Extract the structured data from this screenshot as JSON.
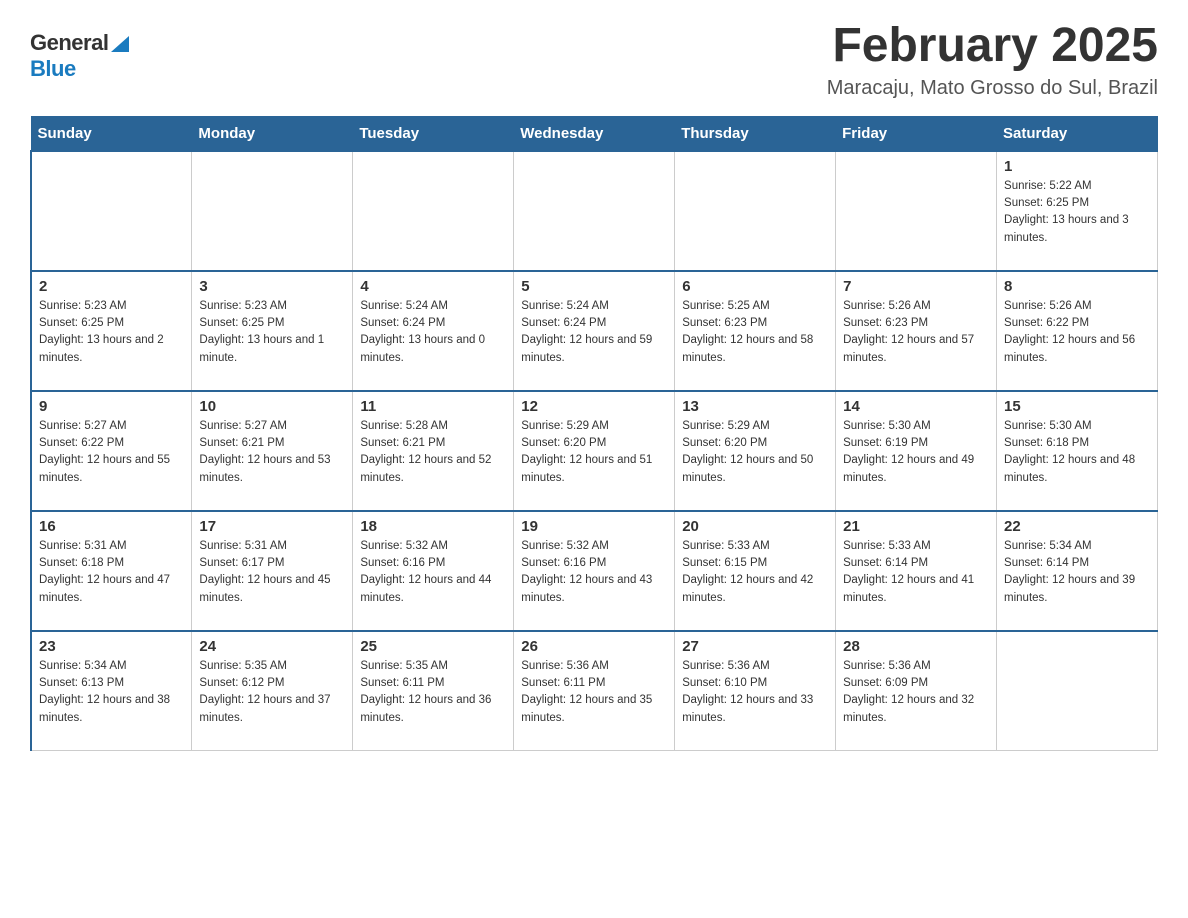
{
  "header": {
    "logo_general": "General",
    "logo_blue": "Blue",
    "title": "February 2025",
    "subtitle": "Maracaju, Mato Grosso do Sul, Brazil"
  },
  "calendar": {
    "days_of_week": [
      "Sunday",
      "Monday",
      "Tuesday",
      "Wednesday",
      "Thursday",
      "Friday",
      "Saturday"
    ],
    "weeks": [
      [
        {
          "day": "",
          "info": ""
        },
        {
          "day": "",
          "info": ""
        },
        {
          "day": "",
          "info": ""
        },
        {
          "day": "",
          "info": ""
        },
        {
          "day": "",
          "info": ""
        },
        {
          "day": "",
          "info": ""
        },
        {
          "day": "1",
          "info": "Sunrise: 5:22 AM\nSunset: 6:25 PM\nDaylight: 13 hours and 3 minutes."
        }
      ],
      [
        {
          "day": "2",
          "info": "Sunrise: 5:23 AM\nSunset: 6:25 PM\nDaylight: 13 hours and 2 minutes."
        },
        {
          "day": "3",
          "info": "Sunrise: 5:23 AM\nSunset: 6:25 PM\nDaylight: 13 hours and 1 minute."
        },
        {
          "day": "4",
          "info": "Sunrise: 5:24 AM\nSunset: 6:24 PM\nDaylight: 13 hours and 0 minutes."
        },
        {
          "day": "5",
          "info": "Sunrise: 5:24 AM\nSunset: 6:24 PM\nDaylight: 12 hours and 59 minutes."
        },
        {
          "day": "6",
          "info": "Sunrise: 5:25 AM\nSunset: 6:23 PM\nDaylight: 12 hours and 58 minutes."
        },
        {
          "day": "7",
          "info": "Sunrise: 5:26 AM\nSunset: 6:23 PM\nDaylight: 12 hours and 57 minutes."
        },
        {
          "day": "8",
          "info": "Sunrise: 5:26 AM\nSunset: 6:22 PM\nDaylight: 12 hours and 56 minutes."
        }
      ],
      [
        {
          "day": "9",
          "info": "Sunrise: 5:27 AM\nSunset: 6:22 PM\nDaylight: 12 hours and 55 minutes."
        },
        {
          "day": "10",
          "info": "Sunrise: 5:27 AM\nSunset: 6:21 PM\nDaylight: 12 hours and 53 minutes."
        },
        {
          "day": "11",
          "info": "Sunrise: 5:28 AM\nSunset: 6:21 PM\nDaylight: 12 hours and 52 minutes."
        },
        {
          "day": "12",
          "info": "Sunrise: 5:29 AM\nSunset: 6:20 PM\nDaylight: 12 hours and 51 minutes."
        },
        {
          "day": "13",
          "info": "Sunrise: 5:29 AM\nSunset: 6:20 PM\nDaylight: 12 hours and 50 minutes."
        },
        {
          "day": "14",
          "info": "Sunrise: 5:30 AM\nSunset: 6:19 PM\nDaylight: 12 hours and 49 minutes."
        },
        {
          "day": "15",
          "info": "Sunrise: 5:30 AM\nSunset: 6:18 PM\nDaylight: 12 hours and 48 minutes."
        }
      ],
      [
        {
          "day": "16",
          "info": "Sunrise: 5:31 AM\nSunset: 6:18 PM\nDaylight: 12 hours and 47 minutes."
        },
        {
          "day": "17",
          "info": "Sunrise: 5:31 AM\nSunset: 6:17 PM\nDaylight: 12 hours and 45 minutes."
        },
        {
          "day": "18",
          "info": "Sunrise: 5:32 AM\nSunset: 6:16 PM\nDaylight: 12 hours and 44 minutes."
        },
        {
          "day": "19",
          "info": "Sunrise: 5:32 AM\nSunset: 6:16 PM\nDaylight: 12 hours and 43 minutes."
        },
        {
          "day": "20",
          "info": "Sunrise: 5:33 AM\nSunset: 6:15 PM\nDaylight: 12 hours and 42 minutes."
        },
        {
          "day": "21",
          "info": "Sunrise: 5:33 AM\nSunset: 6:14 PM\nDaylight: 12 hours and 41 minutes."
        },
        {
          "day": "22",
          "info": "Sunrise: 5:34 AM\nSunset: 6:14 PM\nDaylight: 12 hours and 39 minutes."
        }
      ],
      [
        {
          "day": "23",
          "info": "Sunrise: 5:34 AM\nSunset: 6:13 PM\nDaylight: 12 hours and 38 minutes."
        },
        {
          "day": "24",
          "info": "Sunrise: 5:35 AM\nSunset: 6:12 PM\nDaylight: 12 hours and 37 minutes."
        },
        {
          "day": "25",
          "info": "Sunrise: 5:35 AM\nSunset: 6:11 PM\nDaylight: 12 hours and 36 minutes."
        },
        {
          "day": "26",
          "info": "Sunrise: 5:36 AM\nSunset: 6:11 PM\nDaylight: 12 hours and 35 minutes."
        },
        {
          "day": "27",
          "info": "Sunrise: 5:36 AM\nSunset: 6:10 PM\nDaylight: 12 hours and 33 minutes."
        },
        {
          "day": "28",
          "info": "Sunrise: 5:36 AM\nSunset: 6:09 PM\nDaylight: 12 hours and 32 minutes."
        },
        {
          "day": "",
          "info": ""
        }
      ]
    ]
  }
}
